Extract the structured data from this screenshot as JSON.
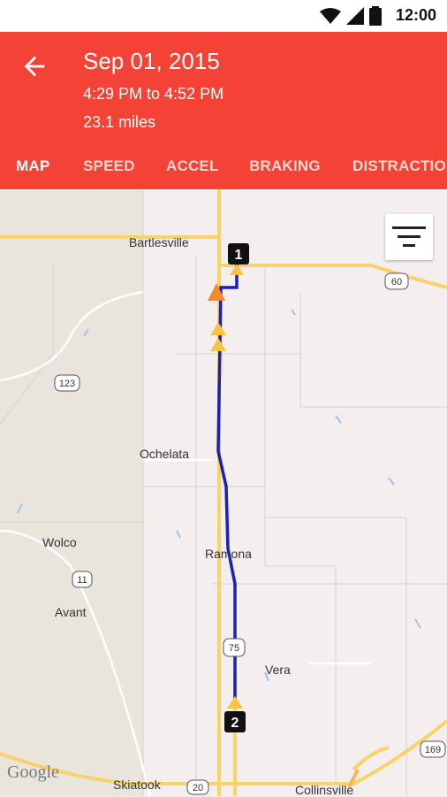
{
  "status": {
    "time": "12:00"
  },
  "header": {
    "date": "Sep 01, 2015",
    "time_range": "4:29 PM to 4:52 PM",
    "distance": "23.1 miles",
    "color": "#f44336"
  },
  "tabs": [
    {
      "label": "MAP",
      "active": true
    },
    {
      "label": "SPEED",
      "active": false
    },
    {
      "label": "ACCEL",
      "active": false
    },
    {
      "label": "BRAKING",
      "active": false
    },
    {
      "label": "DISTRACTION",
      "active": false
    }
  ],
  "map": {
    "places": [
      "Bartlesville",
      "Ochelata",
      "Wolco",
      "Ramona",
      "Avant",
      "Vera",
      "Skiatook",
      "Collinsville"
    ],
    "road_shields": [
      "60",
      "123",
      "11",
      "75",
      "169",
      "20"
    ],
    "markers": {
      "start": "1",
      "end": "2"
    },
    "attribution": "Google"
  },
  "icons": {
    "back": "arrow-left-icon",
    "filter": "filter-icon"
  }
}
